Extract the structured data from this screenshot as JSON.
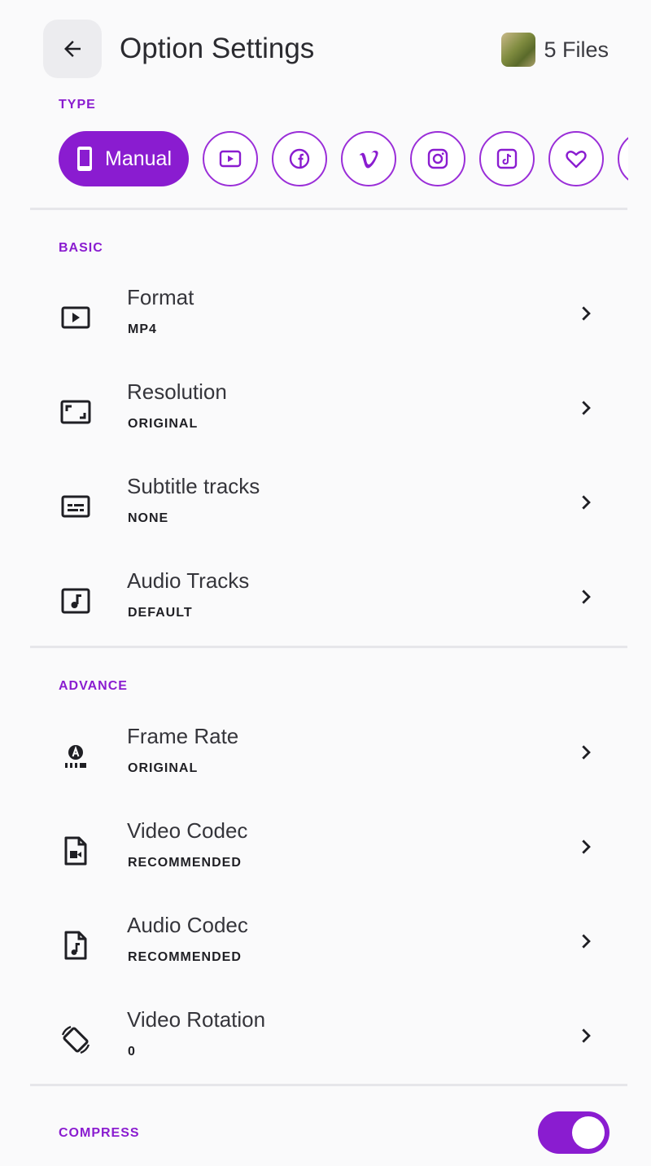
{
  "header": {
    "title": "Option Settings",
    "files_label": "5 Files",
    "back_icon": "arrow-left-icon"
  },
  "type_section": {
    "label": "TYPE",
    "selected": "Manual",
    "options": [
      {
        "name": "Manual",
        "icon": "phone-icon"
      },
      {
        "name": "YouTube",
        "icon": "youtube-icon"
      },
      {
        "name": "Facebook",
        "icon": "facebook-icon"
      },
      {
        "name": "Vimeo",
        "icon": "vimeo-icon"
      },
      {
        "name": "Instagram",
        "icon": "instagram-icon"
      },
      {
        "name": "TikTok",
        "icon": "tiktok-icon"
      },
      {
        "name": "Favorite",
        "icon": "heart-icon"
      }
    ]
  },
  "basic": {
    "label": "BASIC",
    "items": [
      {
        "title": "Format",
        "value": "MP4",
        "icon": "play-box-icon"
      },
      {
        "title": "Resolution",
        "value": "ORIGINAL",
        "icon": "aspect-ratio-icon"
      },
      {
        "title": "Subtitle tracks",
        "value": "NONE",
        "icon": "subtitles-icon"
      },
      {
        "title": "Audio Tracks",
        "value": "DEFAULT",
        "icon": "music-note-box-icon"
      }
    ]
  },
  "advance": {
    "label": "ADVANCE",
    "items": [
      {
        "title": "Frame Rate",
        "value": "ORIGINAL",
        "icon": "frame-rate-auto-icon"
      },
      {
        "title": "Video Codec",
        "value": "RECOMMENDED",
        "icon": "video-file-icon"
      },
      {
        "title": "Audio Codec",
        "value": "RECOMMENDED",
        "icon": "audio-file-icon"
      },
      {
        "title": "Video Rotation",
        "value": "0",
        "icon": "screen-rotation-icon"
      }
    ]
  },
  "compress": {
    "label": "COMPRESS",
    "enabled": true
  },
  "colors": {
    "accent": "#8a1cd0",
    "background": "#fafafb",
    "divider": "#e6e6ea"
  }
}
